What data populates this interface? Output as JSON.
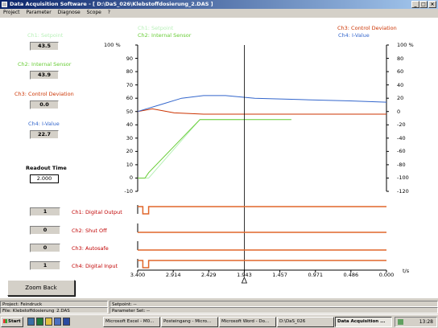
{
  "window": {
    "title": "Data Acquisition Software - [ D:\\DaS_026\\Klebstoffdosierung_2.DAS ]",
    "buttons": [
      "_",
      "□",
      "×"
    ]
  },
  "menu": [
    "Project",
    "Parameter",
    "Diagnose",
    "Scope",
    "?"
  ],
  "channels": [
    {
      "label": "Ch1: Setpoint",
      "value": "43.5",
      "color": "#b8f0b8"
    },
    {
      "label": "Ch2: Internal Sensor",
      "value": "43.9",
      "color": "#66cc33"
    },
    {
      "label": "Ch3: Control Deviation",
      "value": "0.0",
      "color": "#cc3300"
    },
    {
      "label": "Ch4: I-Value",
      "value": "22.7",
      "color": "#3366cc"
    }
  ],
  "readout": {
    "label": "Readout Time",
    "value": "2.000"
  },
  "legend": {
    "ch1": "Ch1: Setpoint",
    "ch2": "Ch2: Internal Sensor",
    "ch3": "Ch3: Control Deviation",
    "ch4": "Ch4: I-Value"
  },
  "left_axis": [
    "100 %",
    "90",
    "80",
    "70",
    "60",
    "50",
    "40",
    "30",
    "20",
    "10",
    "0",
    "-10"
  ],
  "right_axis": [
    "100 %",
    "80",
    "60",
    "40",
    "20",
    "0",
    "-20",
    "-40",
    "-60",
    "-80",
    "-100",
    "-120"
  ],
  "digital": [
    {
      "value": "1",
      "label": "Ch1: Digital Output"
    },
    {
      "value": "0",
      "label": "Ch2: Shut Off"
    },
    {
      "value": "0",
      "label": "Ch3: Autosafe"
    },
    {
      "value": "1",
      "label": "Ch4: Digital Input"
    }
  ],
  "x_axis": {
    "unit": "t/s",
    "ticks": [
      "3.400",
      "2.914",
      "2.429",
      "1.943",
      "1.457",
      "0.971",
      "0.486",
      "0.000"
    ]
  },
  "zoom_button": "Zoom Back",
  "status": {
    "project": "Project: Feindruck",
    "setpoint": "Setpoint: --",
    "file": "File: Klebstoffdosierung_2.DAS",
    "parameter_set": "Parameter Set: --"
  },
  "taskbar": {
    "start": "Start",
    "tasks": [
      "Microsoft Excel - M0...",
      "Posteingang - Micro...",
      "Microsoft Word - Do...",
      "D:\\DaS_026",
      "Data Acquisition ..."
    ],
    "clock": "13:28"
  },
  "chart_data": {
    "type": "line",
    "x_label": "t/s",
    "x_range": [
      3.4,
      0.0
    ],
    "y_left_range": [
      -10,
      100
    ],
    "y_right_range": [
      -120,
      100
    ],
    "cursor_x": 1.943,
    "series": [
      {
        "name": "Ch1: Setpoint",
        "color": "#b8f0b8",
        "axis": "left",
        "points": [
          [
            3.4,
            0
          ],
          [
            3.25,
            0
          ],
          [
            2.55,
            44
          ],
          [
            2.0,
            44
          ]
        ]
      },
      {
        "name": "Ch2: Internal Sensor",
        "color": "#66cc33",
        "axis": "left",
        "points": [
          [
            3.4,
            0
          ],
          [
            3.3,
            0
          ],
          [
            3.25,
            4
          ],
          [
            2.55,
            44
          ],
          [
            1.5,
            44
          ],
          [
            1.3,
            44
          ]
        ]
      },
      {
        "name": "Ch3: Control Deviation",
        "color": "#cc3300",
        "axis": "left",
        "points": [
          [
            3.4,
            50
          ],
          [
            3.2,
            52
          ],
          [
            2.9,
            49
          ],
          [
            2.5,
            48
          ],
          [
            2.0,
            48
          ],
          [
            1.0,
            48
          ],
          [
            0.0,
            48
          ]
        ]
      },
      {
        "name": "Ch4: I-Value",
        "color": "#3366cc",
        "axis": "left",
        "points": [
          [
            3.4,
            50
          ],
          [
            3.1,
            55
          ],
          [
            2.8,
            60
          ],
          [
            2.5,
            62
          ],
          [
            2.2,
            62
          ],
          [
            1.8,
            60
          ],
          [
            1.2,
            59
          ],
          [
            0.5,
            58
          ],
          [
            0.0,
            57
          ]
        ]
      }
    ],
    "digital_series": [
      {
        "name": "Ch1: Digital Output",
        "transitions": [
          [
            3.4,
            1
          ],
          [
            3.33,
            0
          ],
          [
            3.25,
            1
          ],
          [
            0.0,
            1
          ]
        ]
      },
      {
        "name": "Ch2: Shut Off",
        "transitions": [
          [
            3.4,
            0
          ],
          [
            0.0,
            0
          ]
        ]
      },
      {
        "name": "Ch3: Autosafe",
        "transitions": [
          [
            3.4,
            0
          ],
          [
            0.0,
            0
          ]
        ]
      },
      {
        "name": "Ch4: Digital Input",
        "transitions": [
          [
            3.4,
            1
          ],
          [
            3.33,
            0
          ],
          [
            3.25,
            1
          ],
          [
            0.0,
            1
          ]
        ]
      }
    ]
  }
}
